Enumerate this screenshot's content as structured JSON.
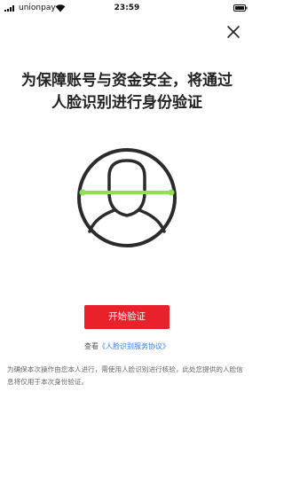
{
  "status_bar": {
    "carrier": "unionpay",
    "time": "23:59",
    "signal_icon": "signal-bars-icon",
    "wifi_icon": "wifi-icon",
    "battery_icon": "battery-icon"
  },
  "header": {
    "close_icon": "close-icon"
  },
  "main": {
    "title_line1": "为保障账号与资金安全，将通过",
    "title_line2": "人脸识别进行身份验证",
    "illustration_icon": "face-scan-icon",
    "start_button_label": "开始验证",
    "agreement_prefix": "查看",
    "agreement_link": "《人脸识别服务协议》",
    "notice": "为确保本次操作由您本人进行，需使用人脸识别进行核验，此处您提供的人脸信息将仅用于本次身份验证。"
  },
  "colors": {
    "accent_red": "#e9212b",
    "scan_line_green": "#8ee05a",
    "link_blue": "#2a7ee6",
    "icon_dark": "#2b2b2b"
  }
}
